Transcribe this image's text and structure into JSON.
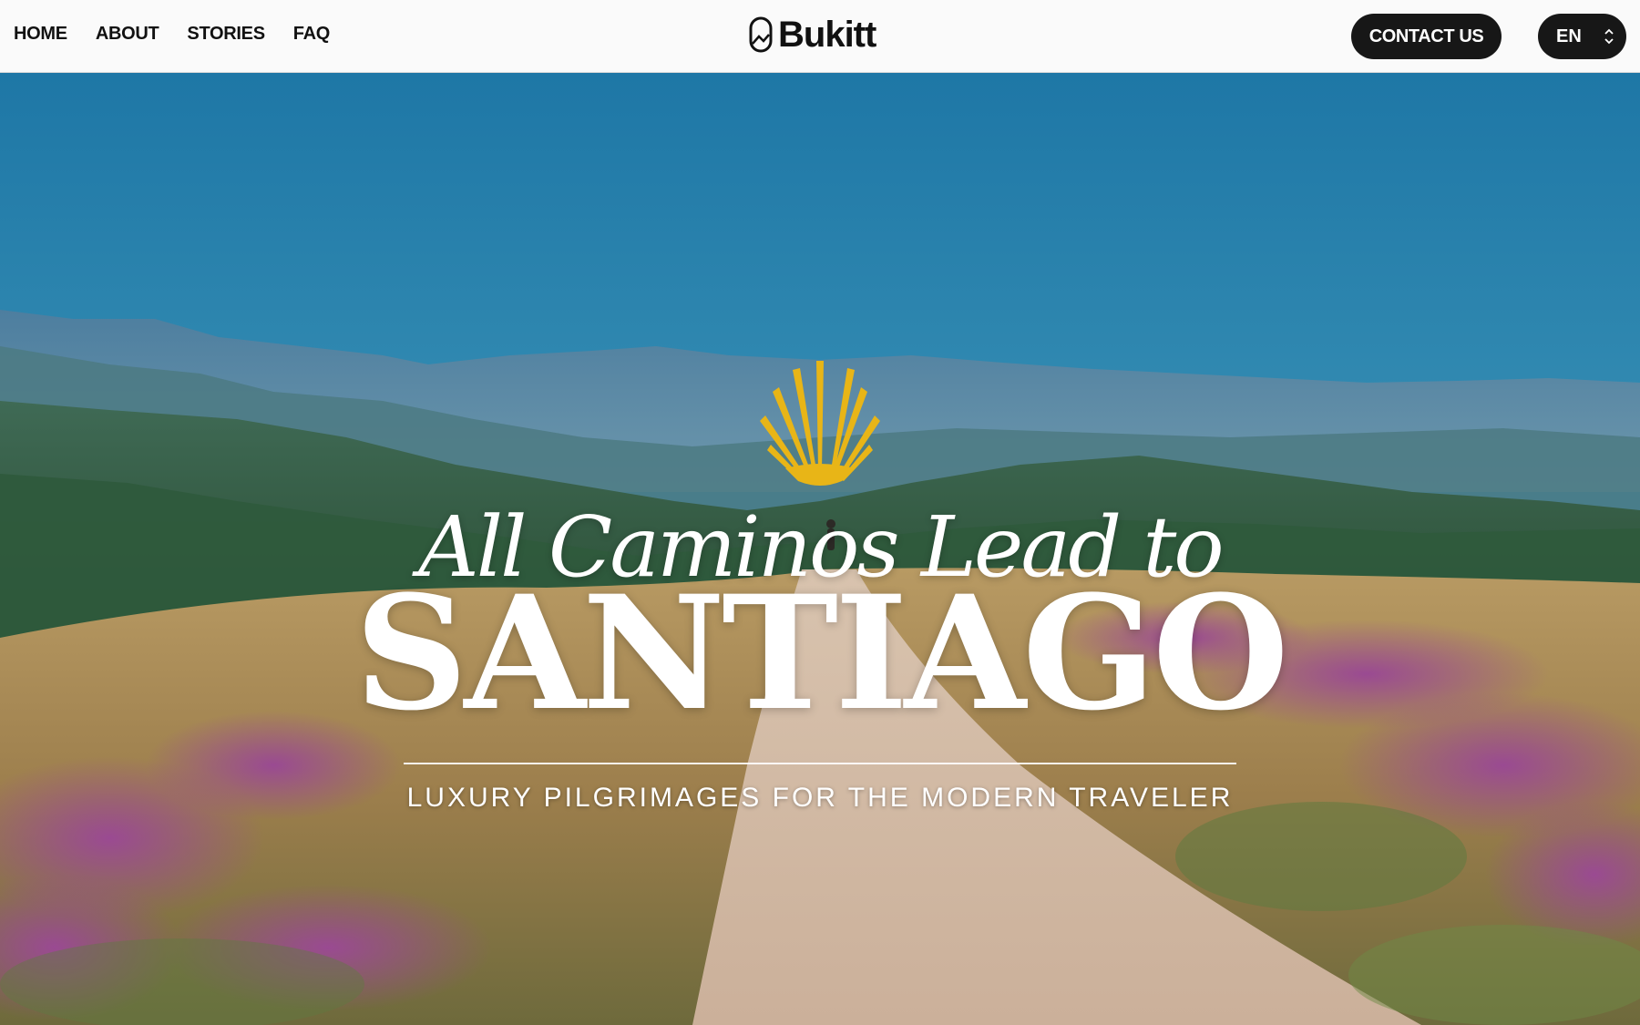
{
  "nav": {
    "items": [
      {
        "label": "HOME"
      },
      {
        "label": "ABOUT"
      },
      {
        "label": "STORIES"
      },
      {
        "label": "FAQ"
      }
    ]
  },
  "brand": {
    "name": "Bukitt",
    "logo_icon": "pilgrim-badge-icon"
  },
  "header": {
    "contact_label": "CONTACT US",
    "language": "EN",
    "language_icon": "chevron-up-down-icon"
  },
  "hero": {
    "emblem": "scallop-shell-icon",
    "script_line": "All Caminos Lead to",
    "headline": "SANTIAGO",
    "subtitle": "LUXURY PILGRIMAGES FOR THE MODERN TRAVELER",
    "background": "photo of a dirt trail across heather-covered hills under a blue sky"
  },
  "colors": {
    "header_bg": "#fafafa",
    "button_bg": "#171717",
    "accent_gold": "#e8b517",
    "text_dark": "#111111",
    "text_light": "#ffffff"
  }
}
